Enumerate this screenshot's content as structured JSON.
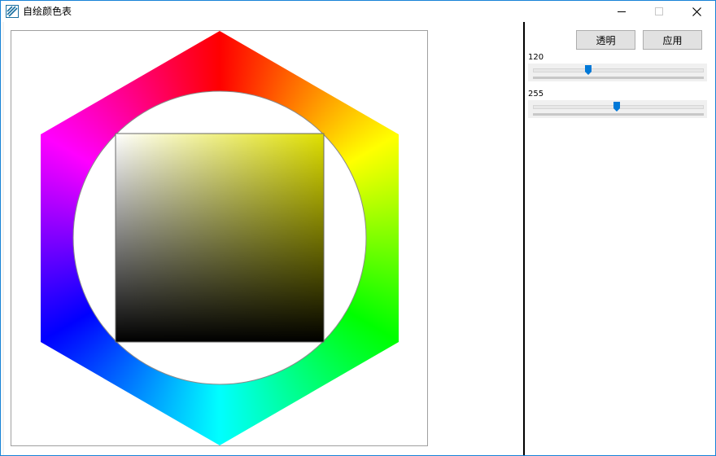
{
  "window": {
    "title": "自绘颜色表",
    "icon": "app-palette-icon",
    "controls": [
      "minimize-icon",
      "maximize-icon",
      "close-icon"
    ]
  },
  "toolbar": {
    "transparent_label": "透明",
    "apply_label": "应用"
  },
  "sliders": [
    {
      "value_label": "120",
      "value": 120,
      "max": 255
    },
    {
      "value_label": "255",
      "value": 255,
      "max": 255
    }
  ],
  "color_picker": {
    "hue_ring_colors": [
      "#ff0000",
      "#ffff00",
      "#00ff00",
      "#00ffff",
      "#0000ff",
      "#ff00ff"
    ],
    "selected_hue": "#e0e000",
    "accent": "#0078d7"
  }
}
